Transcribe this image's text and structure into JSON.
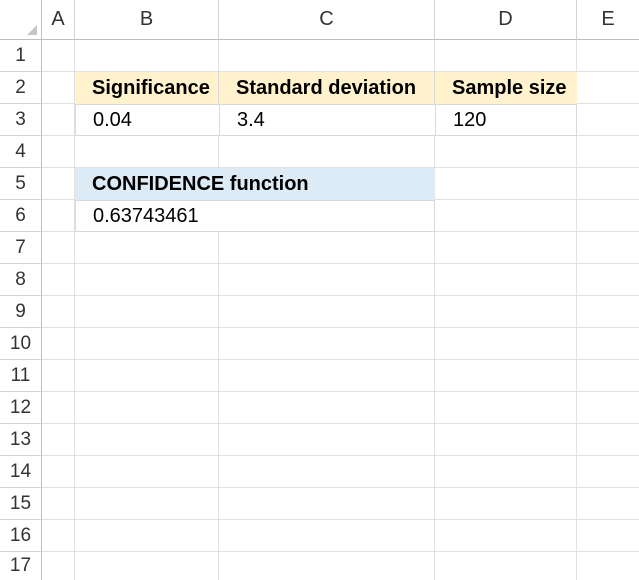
{
  "columns": [
    "A",
    "B",
    "C",
    "D",
    "E"
  ],
  "rows": [
    "1",
    "2",
    "3",
    "4",
    "5",
    "6",
    "7",
    "8",
    "9",
    "10",
    "11",
    "12",
    "13",
    "14",
    "15",
    "16",
    "17"
  ],
  "table1": {
    "headers": [
      "Significance",
      "Standard deviation",
      "Sample size"
    ],
    "values": [
      "0.04",
      "3.4",
      "120"
    ]
  },
  "table2": {
    "header": "CONFIDENCE function",
    "value": "0.63743461"
  },
  "colors": {
    "header_yellow": "#fff2cc",
    "header_blue": "#ddebf7",
    "grid": "#e1e1e1"
  }
}
